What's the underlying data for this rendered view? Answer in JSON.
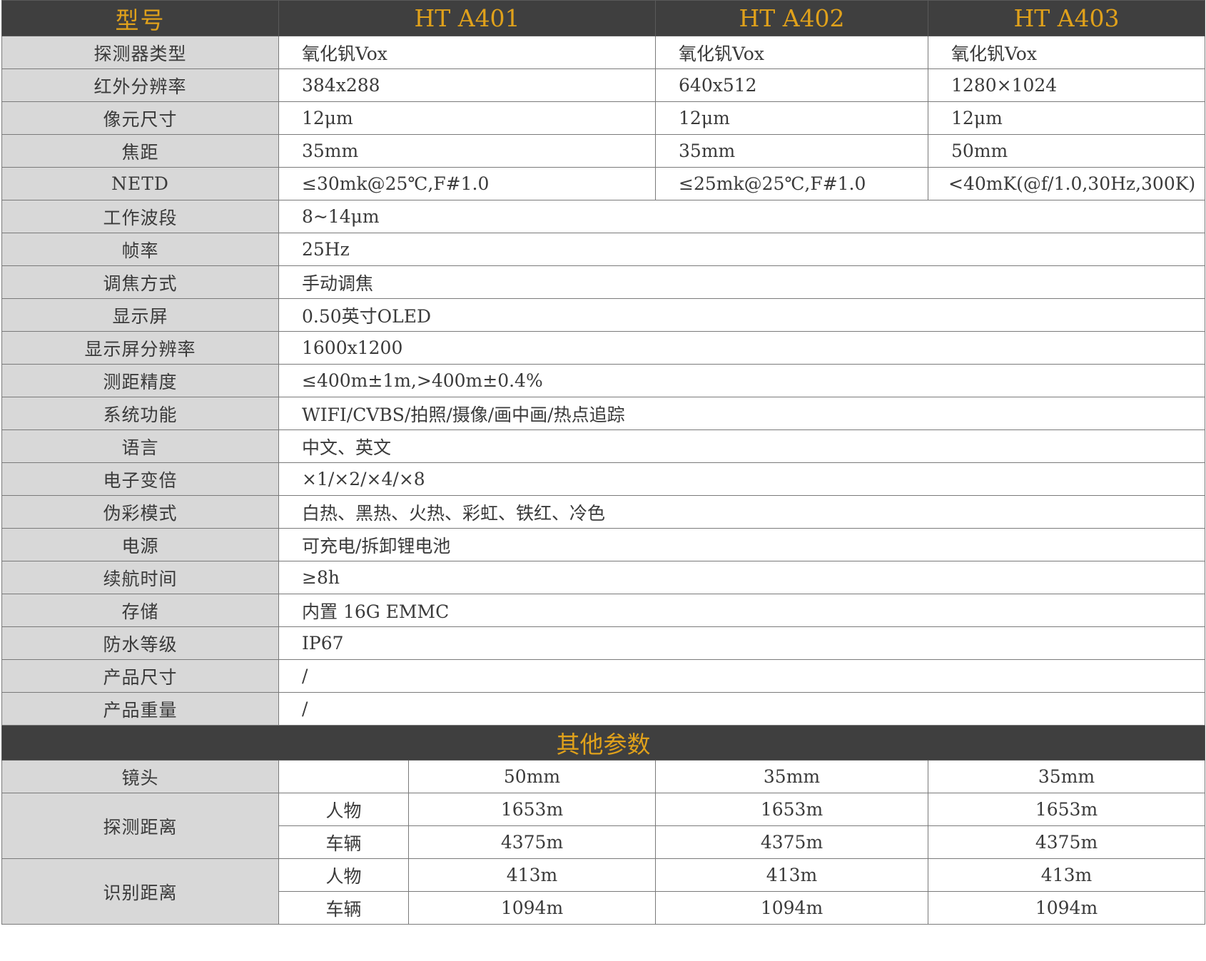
{
  "header": {
    "label": "型号",
    "models": [
      "HT A401",
      "HT A402",
      "HT A403"
    ]
  },
  "specs_split": [
    {
      "label": "探测器类型",
      "values": [
        "氧化钒Vox",
        "氧化钒Vox",
        "氧化钒Vox"
      ]
    },
    {
      "label": "红外分辨率",
      "values": [
        "384x288",
        "640x512",
        "1280×1024"
      ]
    },
    {
      "label": "像元尺寸",
      "values": [
        "12μm",
        "12μm",
        "12μm"
      ]
    },
    {
      "label": "焦距",
      "values": [
        "35mm",
        "35mm",
        "50mm"
      ]
    },
    {
      "label": "NETD",
      "values": [
        "≤30mk@25℃,F#1.0",
        "≤25mk@25℃,F#1.0",
        "<40mK(@f/1.0,30Hz,300K)"
      ]
    }
  ],
  "specs_merged": [
    {
      "label": "工作波段",
      "value": "8~14μm"
    },
    {
      "label": "帧率",
      "value": "25Hz"
    },
    {
      "label": "调焦方式",
      "value": "手动调焦"
    },
    {
      "label": "显示屏",
      "value": "0.50英寸OLED"
    },
    {
      "label": "显示屏分辨率",
      "value": "1600x1200"
    },
    {
      "label": "测距精度",
      "value": "≤400m±1m,>400m±0.4%"
    },
    {
      "label": "系统功能",
      "value": "WIFI/CVBS/拍照/摄像/画中画/热点追踪"
    },
    {
      "label": "语言",
      "value": "中文、英文"
    },
    {
      "label": "电子变倍",
      "value": "×1/×2/×4/×8"
    },
    {
      "label": "伪彩模式",
      "value": "白热、黑热、火热、彩虹、铁红、冷色"
    },
    {
      "label": "电源",
      "value": "可充电/拆卸锂电池"
    },
    {
      "label": "续航时间",
      "value": "≥8h"
    },
    {
      "label": "存储",
      "value": "内置 16G EMMC"
    },
    {
      "label": "防水等级",
      "value": "IP67"
    },
    {
      "label": "产品尺寸",
      "value": "/"
    },
    {
      "label": "产品重量",
      "value": "/"
    }
  ],
  "other": {
    "title": "其他参数",
    "lens": {
      "label": "镜头",
      "values": [
        "50mm",
        "35mm",
        "35mm"
      ]
    },
    "detection": {
      "label": "探测距离",
      "rows": [
        {
          "target": "人物",
          "values": [
            "1653m",
            "1653m",
            "1653m"
          ]
        },
        {
          "target": "车辆",
          "values": [
            "4375m",
            "4375m",
            "4375m"
          ]
        }
      ]
    },
    "recognition": {
      "label": "识别距离",
      "rows": [
        {
          "target": "人物",
          "values": [
            "413m",
            "413m",
            "413m"
          ]
        },
        {
          "target": "车辆",
          "values": [
            "1094m",
            "1094m",
            "1094m"
          ]
        }
      ]
    }
  }
}
